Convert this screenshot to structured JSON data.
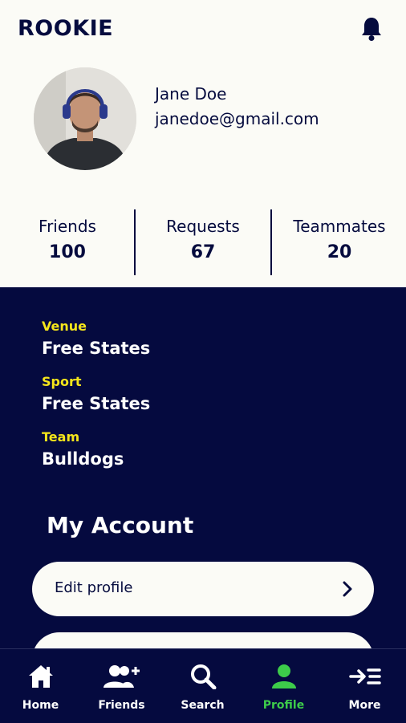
{
  "app": {
    "title": "ROOKIE"
  },
  "profile": {
    "name": "Jane Doe",
    "email": "janedoe@gmail.com"
  },
  "stats": [
    {
      "label": "Friends",
      "value": "100"
    },
    {
      "label": "Requests",
      "value": "67"
    },
    {
      "label": "Teammates",
      "value": "20"
    }
  ],
  "details": [
    {
      "label": "Venue",
      "value": "Free States"
    },
    {
      "label": "Sport",
      "value": "Free States"
    },
    {
      "label": "Team",
      "value": "Bulldogs"
    }
  ],
  "account": {
    "title": "My Account",
    "items": [
      {
        "label": "Edit profile"
      }
    ]
  },
  "nav": [
    {
      "label": "Home",
      "icon": "home-icon"
    },
    {
      "label": "Friends",
      "icon": "friends-add-icon"
    },
    {
      "label": "Search",
      "icon": "search-icon"
    },
    {
      "label": "Profile",
      "icon": "profile-icon",
      "active": true
    },
    {
      "label": "More",
      "icon": "more-icon"
    }
  ],
  "colors": {
    "navy": "#050a3f",
    "yellow": "#f5e51b",
    "green": "#3dcc4a",
    "cream": "#fbfbf6"
  }
}
